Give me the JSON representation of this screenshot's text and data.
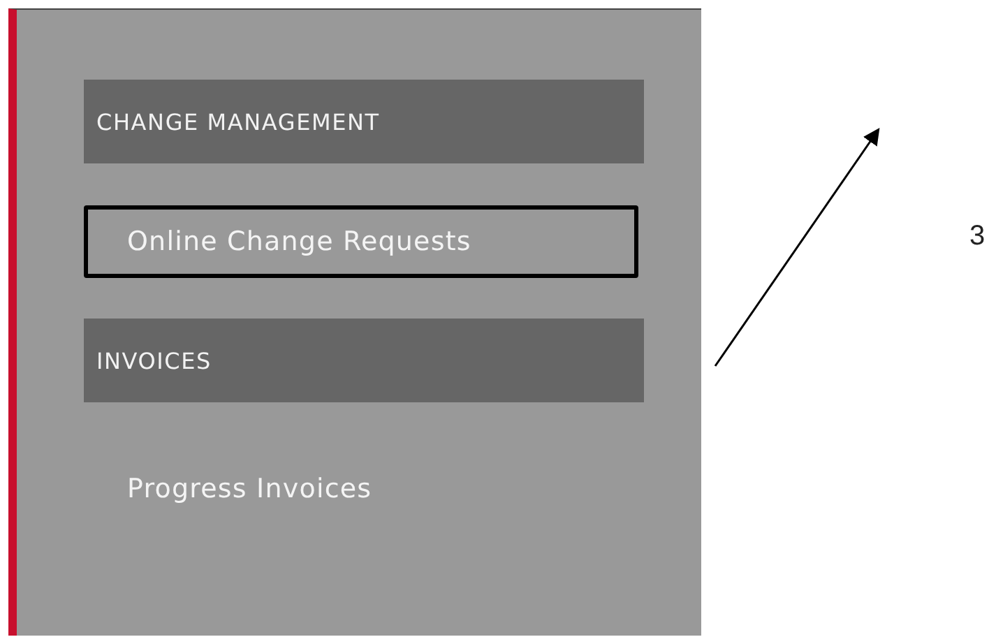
{
  "menu": [
    {
      "kind": "header",
      "label": "CHANGE MANAGEMENT",
      "outlined": false
    },
    {
      "kind": "link",
      "label": "Online Change Requests",
      "outlined": true
    },
    {
      "kind": "header",
      "label": "INVOICES",
      "outlined": false
    },
    {
      "kind": "link",
      "label": "Progress Invoices",
      "outlined": false
    }
  ],
  "annotation": {
    "label": "3"
  }
}
